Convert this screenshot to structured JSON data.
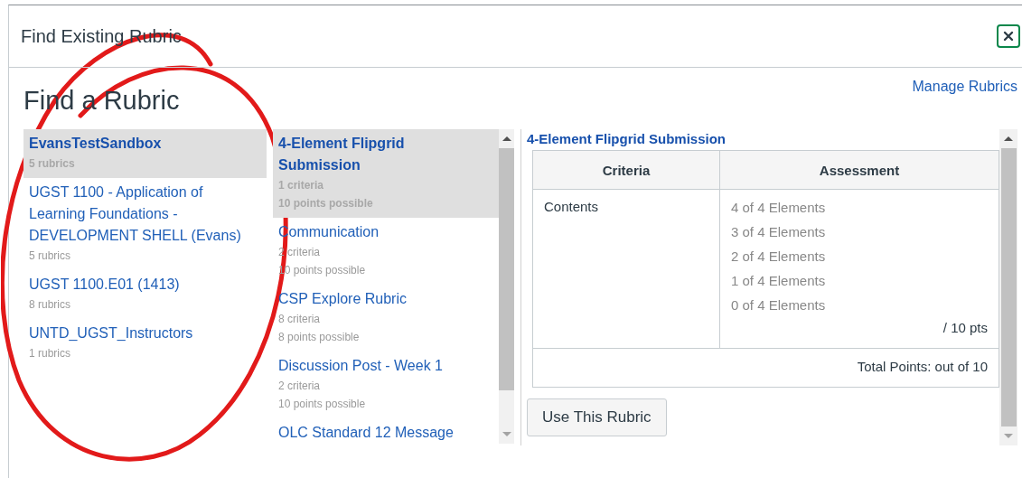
{
  "dialog": {
    "title": "Find Existing Rubric"
  },
  "heading": "Find a Rubric",
  "manage_link": "Manage Rubrics",
  "contexts": [
    {
      "name": "EvansTestSandbox",
      "count": "5 rubrics",
      "selected": true
    },
    {
      "name": "UGST 1100 - Application of Learning Foundations - DEVELOPMENT SHELL (Evans)",
      "count": "5 rubrics",
      "selected": false
    },
    {
      "name": "UGST 1100.E01 (1413)",
      "count": "8 rubrics",
      "selected": false
    },
    {
      "name": "UNTD_UGST_Instructors",
      "count": "1 rubrics",
      "selected": false
    }
  ],
  "rubrics": [
    {
      "title": "4-Element Flipgrid Submission",
      "criteria": "1 criteria",
      "points": "10 points possible",
      "selected": true
    },
    {
      "title": "Communication",
      "criteria": "2 criteria",
      "points": "10 points possible",
      "selected": false
    },
    {
      "title": "CSP Explore Rubric",
      "criteria": "8 criteria",
      "points": "8 points possible",
      "selected": false
    },
    {
      "title": "Discussion Post - Week 1",
      "criteria": "2 criteria",
      "points": "10 points possible",
      "selected": false
    },
    {
      "title": "OLC Standard 12 Message",
      "selected": false
    }
  ],
  "preview": {
    "title": "4-Element Flipgrid Submission",
    "columns": [
      "Criteria",
      "Assessment"
    ],
    "rows": [
      {
        "criterion": "Contents",
        "ratings": [
          "4 of 4 Elements",
          "3 of 4 Elements",
          "2 of 4 Elements",
          "1 of 4 Elements",
          "0 of 4 Elements"
        ],
        "points": "/ 10 pts"
      }
    ],
    "total": "Total Points: out of 10"
  },
  "use_button": "Use This Rubric"
}
